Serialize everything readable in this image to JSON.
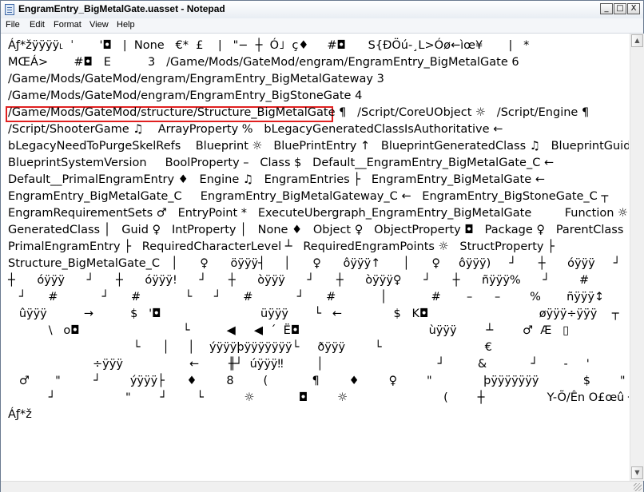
{
  "window": {
    "title": "EngramEntry_BigMetalGate.uasset - Notepad",
    "controls": {
      "minimize": "_",
      "maximize": "□",
      "close": "X"
    }
  },
  "menu": [
    "File",
    "Edit",
    "Format",
    "View",
    "Help"
  ],
  "scroll": {
    "up": "▲",
    "down": "▼"
  },
  "editor": {
    "highlight_color": "#e02020",
    "lines": [
      "Áƒ*žÿÿÿÿ˪  ˈ       '◘   |  None   €*  £    |   \"−  ┼  Ó˩  ç♦     #◘      S{ÐÖú-¸L>Óø←ìœ¥       |   *",
      "MŒÁ>       #◘   E          3   /Game/Mods/GateMod/engram/EngramEntry_BigMetalGate 6",
      "/Game/Mods/GateMod/engram/EngramEntry_BigMetalGateway 3",
      "/Game/Mods/GateMod/engram/EngramEntry_BigStoneGate 4",
      "/Game/Mods/GateMod/structure/Structure_BigMetalGate ¶   /Script/CoreUObject ☼   /Script/Engine ¶",
      "/Script/ShooterGame ♫    ArrayProperty %   bLegacyGeneratedClassIsAuthoritative ←",
      "bLegacyNeedToPurgeSkelRefs    Blueprint ☼   BluePrintEntry ↑   BlueprintGeneratedClass ♫   BlueprintGuid ┤",
      "BlueprintSystemVersion     BoolProperty –   Class $   Default__EngramEntry_BigMetalGate_C ←",
      "Default__PrimalEngramEntry ♦   Engine ♫   EngramEntries ├   EngramEntry_BigMetalGate ←",
      "EngramEntry_BigMetalGate_C     EngramEntry_BigMetalGateway_C ←   EngramEntry_BigStoneGate_C ┬",
      "EngramRequirementSets ♂   EntryPoint *   ExecuteUbergraph_EngramEntry_BigMetalGate         Function ☼",
      "GeneratedClass │   Guid ♀   IntProperty │   None ♦   Object ♀   ObjectProperty ◘   Package ♀   ParentClass ↕",
      "PrimalEngramEntry ├   RequiredCharacterLevel ┴   RequiredEngramPoints ☼   StructProperty ├",
      "Structure_BigMetalGate_C   │      ♀      öÿÿÿ┤     │      ♀      ôÿÿÿ↑      │      ♀     ôÿÿÿ)     ┘      ┼      óÿÿÿ     ┘",
      "┼      óÿÿÿ      ┘      ┼      óÿÿÿ!      ┘      ┼      òÿÿÿ      ┘      ┼      òÿÿÿ♀      ┘      ┼      ñÿÿÿ%      ┘        #",
      "   ┘      #            ┘      #            └      ┘      #            ┘      #            │            #       –      –        %       ñÿÿÿ↕",
      "   ûÿÿÿ          →          $   '◘                           üÿÿÿ       └   ←              $   K◘                              øÿÿÿ÷ÿÿÿ    ┬",
      "           \\   o◘                            └          ◀     ◀  ´  Ë◘                                   ùÿÿÿ        ┴        ♂  Æ   ▯",
      "                                  └      │     │    ýÿÿÿþÿÿÿÿÿÿÿ└     ðÿÿÿ        └                            €",
      "                       ÷ÿÿÿ                  ←        ╫┘  úÿÿÿ‼         │                               ┘         &            ┘       -     '                  ┘",
      "   ♂       \"         ┘        ýÿÿÿ├      ♦        8        (            ¶        ♦        ♀        \"              þÿÿÿÿÿÿÿ            $        \"        ┘       ÷ÿÿÿ♬",
      "           ┘                   \"        ┘        └           ☼            ◘        ☼                          (        ┼                 Y-Õ/Ên O£œû ┤´L˝",
      "",
      "Áƒ*ž"
    ]
  }
}
